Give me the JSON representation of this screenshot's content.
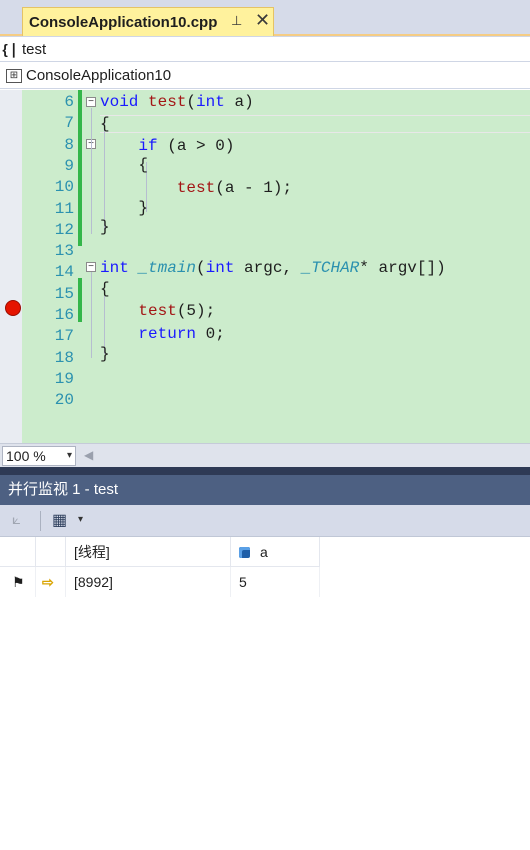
{
  "tab": {
    "title": "ConsoleApplication10.cpp",
    "pin_glyph": "⊥",
    "close_glyph": "✕"
  },
  "nav": {
    "scope_icon": "{❘",
    "scope": "test",
    "project_icon": "⊞",
    "project": "ConsoleApplication10"
  },
  "editor": {
    "line_numbers": [
      "6",
      "7",
      "8",
      "9",
      "10",
      "11",
      "12",
      "13",
      "14",
      "15",
      "16",
      "17",
      "18",
      "19",
      "20"
    ]
  },
  "zoom": {
    "value": "100 %",
    "chevron": "▾",
    "left_arrow": "◀"
  },
  "panel": {
    "title": "并行监视 1 - test",
    "columns": {
      "thread": "[线程]",
      "var": "a"
    },
    "row": {
      "thread": "[8992]",
      "value": "5"
    }
  },
  "icons": {
    "toolbar_filter": "⟀",
    "toolbar_table": "▦",
    "toolbar_chev": "▾",
    "row_flag": "⚑",
    "row_arrow": "⇨"
  },
  "colors": {
    "editor_bg": "#cceccc",
    "breakpoint": "#e51400",
    "panel_title_bg": "#4d6082"
  }
}
